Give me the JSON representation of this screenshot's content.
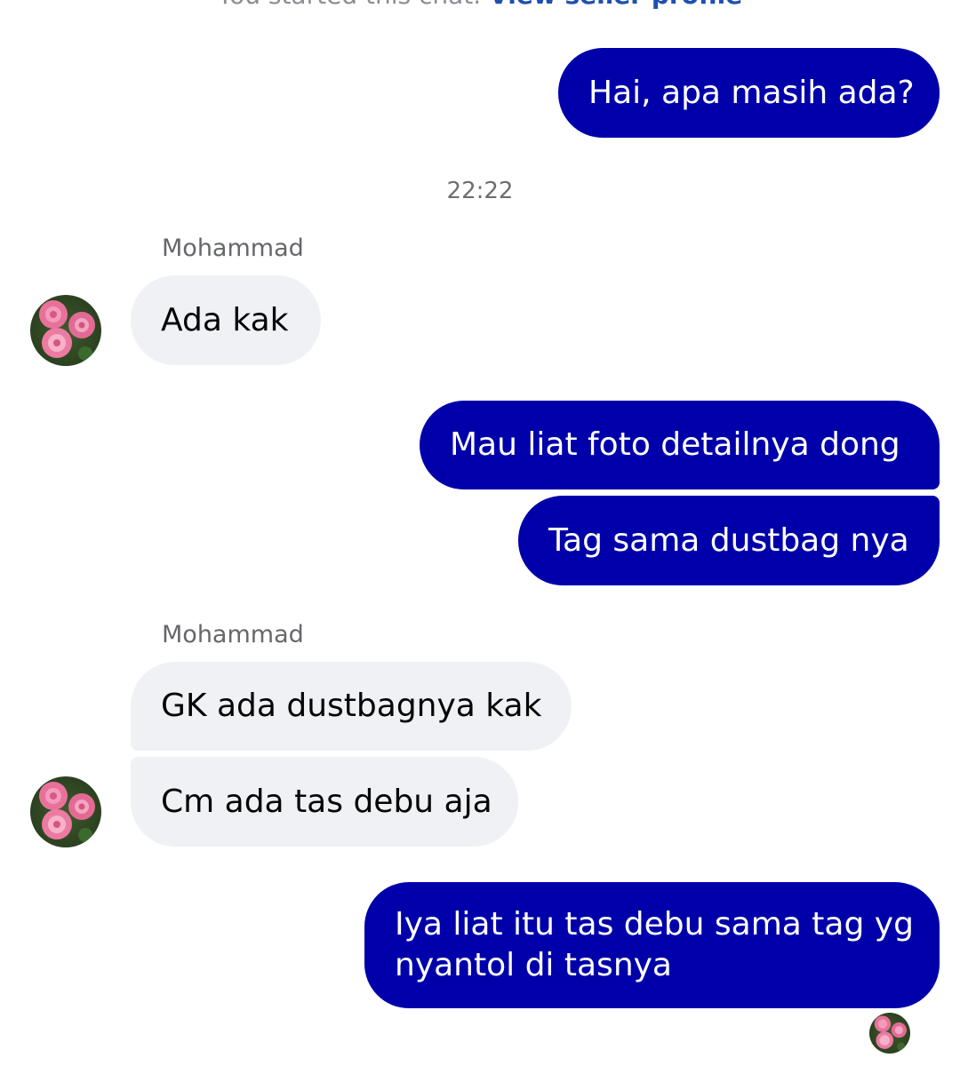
{
  "header": {
    "started_text": "You started this chat.",
    "profile_link": "View seller profile"
  },
  "timestamp": "22:22",
  "messages": [
    {
      "text": "Hai, apa masih ada?"
    },
    {
      "sender": "Mohammad",
      "text": "Ada kak"
    },
    {
      "text": "Mau liat foto detailnya dong"
    },
    {
      "text": "Tag sama dustbag nya"
    },
    {
      "sender": "Mohammad",
      "text": "GK ada dustbagnya kak"
    },
    {
      "text": "Cm ada tas debu aja"
    },
    {
      "line1": "Iya liat itu tas debu sama tag yg",
      "line2": "nyantol di tasnya"
    }
  ],
  "icons": {
    "avatar": "rose-avatar-icon"
  },
  "colors": {
    "outgoing_bubble": "#0000aa",
    "incoming_bubble": "#f0f1f5",
    "link": "#1f4fb0"
  }
}
